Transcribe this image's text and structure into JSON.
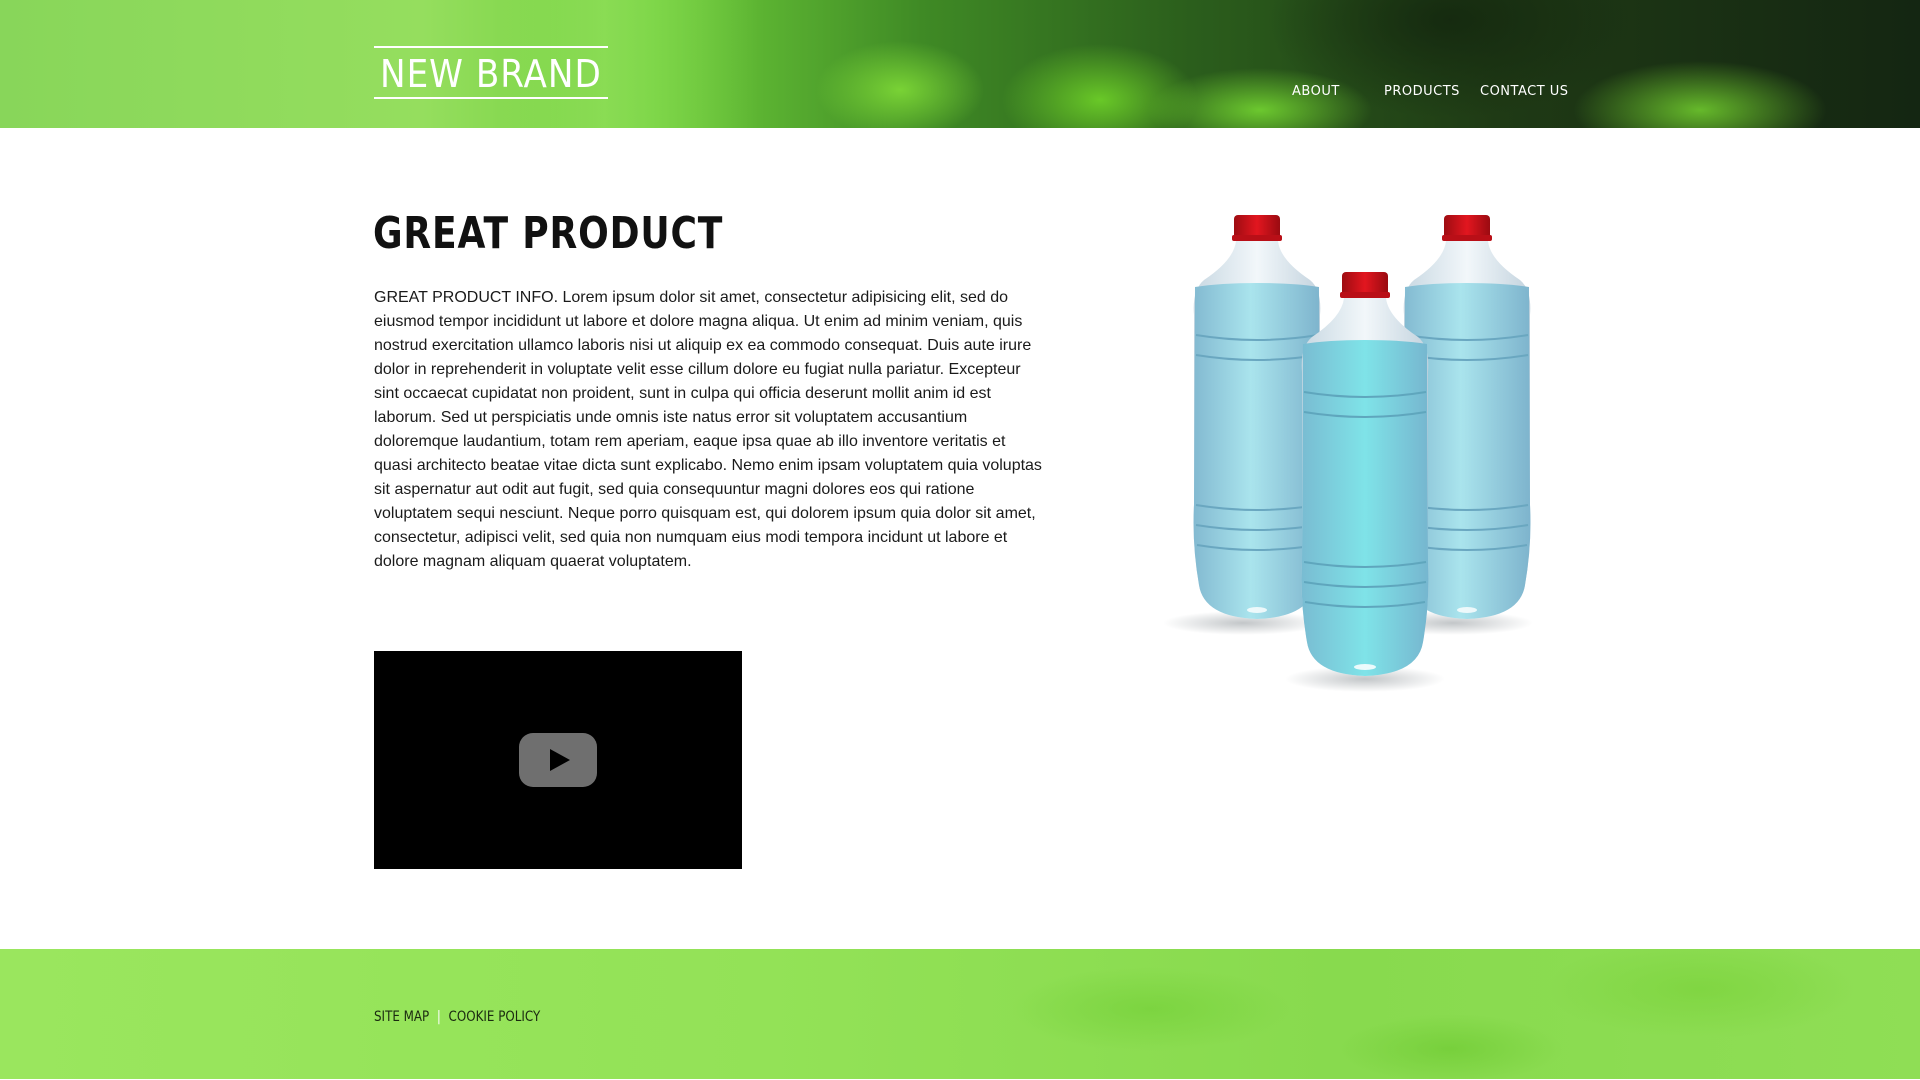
{
  "header": {
    "brand": "NEW BRAND",
    "nav": [
      {
        "label": "ABOUT"
      },
      {
        "label": "PRODUCTS"
      },
      {
        "label": "CONTACT US"
      }
    ]
  },
  "main": {
    "title": "GREAT PRODUCT",
    "body": "GREAT PRODUCT INFO. Lorem ipsum dolor sit amet, consectetur adipisicing elit, sed do eiusmod tempor incididunt ut labore et dolore magna aliqua. Ut enim ad minim veniam, quis nostrud exercitation ullamco laboris nisi ut aliquip ex ea commodo consequat. Duis aute irure dolor in reprehenderit in voluptate velit esse cillum dolore eu fugiat nulla pariatur. Excepteur sint occaecat cupidatat non proident, sunt in culpa qui officia deserunt mollit anim id est laborum. Sed ut perspiciatis unde omnis iste natus error sit voluptatem accusantium doloremque laudantium, totam rem aperiam, eaque ipsa quae ab illo inventore veritatis et quasi architecto beatae vitae dicta sunt explicabo. Nemo enim ipsam voluptatem quia voluptas sit aspernatur aut odit aut fugit, sed quia consequuntur magni dolores eos qui ratione voluptatem sequi nesciunt. Neque porro quisquam est, qui dolorem ipsum quia dolor sit amet, consectetur, adipisci velit, sed quia non numquam eius modi tempora incidunt ut labore et dolore magnam aliquam quaerat voluptatem.",
    "video": {
      "icon": "play-icon"
    },
    "product_image": {
      "icon": "water-bottles-image"
    }
  },
  "footer": {
    "links": [
      {
        "label": "SITE MAP"
      },
      {
        "label": "COOKIE POLICY"
      }
    ],
    "separator": "|"
  },
  "colors": {
    "header_green": "#6fcf3a",
    "footer_green": "#93e257",
    "bottle_cap": "#d1101a",
    "water": "#8fd3e0"
  }
}
